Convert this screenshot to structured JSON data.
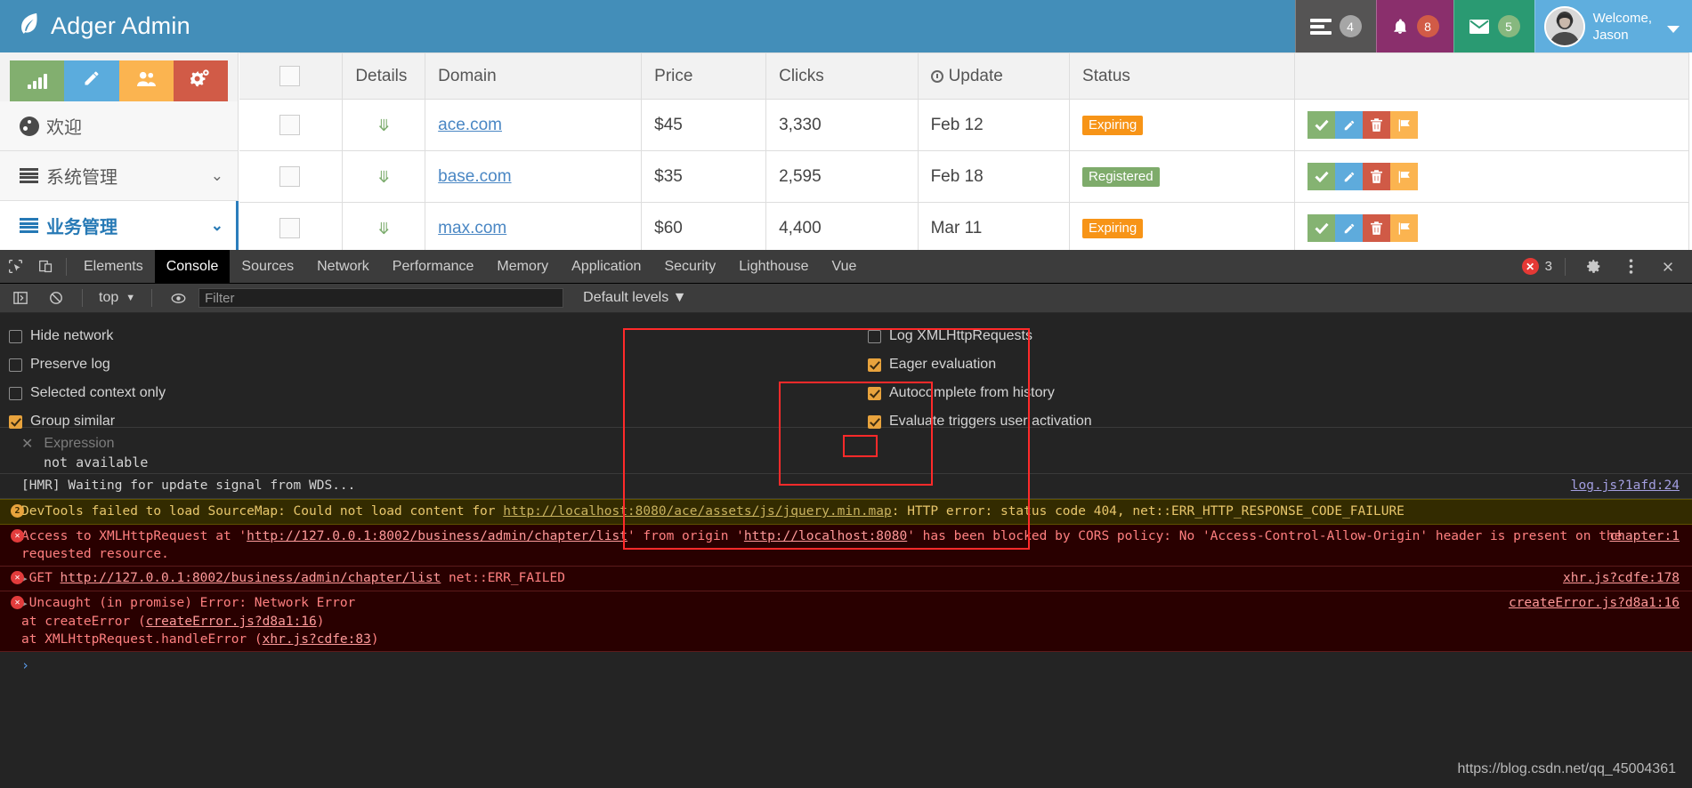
{
  "header": {
    "brand": "Adger Admin",
    "brand_icon": "leaf-icon",
    "tasks": {
      "icon": "tasks-icon",
      "count": "4"
    },
    "notifications": {
      "icon": "bell-icon",
      "count": "8"
    },
    "messages": {
      "icon": "envelope-icon",
      "count": "5"
    },
    "user": {
      "greeting": "Welcome,",
      "name": "Jason",
      "avatar": "user-avatar"
    }
  },
  "sidebar": {
    "quick_actions": [
      {
        "name": "stats-button",
        "icon": "bar-chart-icon",
        "color": "#82af6f"
      },
      {
        "name": "edit-button",
        "icon": "pencil-icon",
        "color": "#5bacdd"
      },
      {
        "name": "users-button",
        "icon": "group-icon",
        "color": "#fbb450"
      },
      {
        "name": "settings-button",
        "icon": "cogs-icon",
        "color": "#d15b47"
      }
    ],
    "items": [
      {
        "label": "欢迎",
        "icon": "dashboard-icon",
        "expandable": false,
        "active": false
      },
      {
        "label": "系统管理",
        "icon": "list-icon",
        "expandable": true,
        "active": false
      },
      {
        "label": "业务管理",
        "icon": "list-icon",
        "expandable": true,
        "active": true
      }
    ]
  },
  "table": {
    "columns": [
      "",
      "Details",
      "Domain",
      "Price",
      "Clicks",
      "Update",
      "Status",
      ""
    ],
    "update_icon": "clock-icon",
    "rows": [
      {
        "domain": "ace.com",
        "price": "$45",
        "clicks": "3,330",
        "update": "Feb 12",
        "status": "Expiring",
        "status_color": "#f79417"
      },
      {
        "domain": "base.com",
        "price": "$35",
        "clicks": "2,595",
        "update": "Feb 18",
        "status": "Registered",
        "status_color": "#7eab6b"
      },
      {
        "domain": "max.com",
        "price": "$60",
        "clicks": "4,400",
        "update": "Mar 11",
        "status": "Expiring",
        "status_color": "#f79417"
      }
    ],
    "row_actions": [
      {
        "name": "approve-button",
        "icon": "check-icon",
        "color": "#85b372"
      },
      {
        "name": "edit-button",
        "icon": "pencil-icon",
        "color": "#5eabdc"
      },
      {
        "name": "delete-button",
        "icon": "trash-icon",
        "color": "#d05a46"
      },
      {
        "name": "flag-button",
        "icon": "flag-icon",
        "color": "#fbb450"
      }
    ]
  },
  "devtools": {
    "tabs": [
      "Elements",
      "Console",
      "Sources",
      "Network",
      "Performance",
      "Memory",
      "Application",
      "Security",
      "Lighthouse",
      "Vue"
    ],
    "selected_tab": "Console",
    "error_count": "3",
    "toolbar": {
      "context": "top",
      "filter_placeholder": "Filter",
      "levels": "Default levels"
    },
    "settings_left": [
      {
        "label": "Hide network",
        "checked": false
      },
      {
        "label": "Preserve log",
        "checked": false
      },
      {
        "label": "Selected context only",
        "checked": false
      },
      {
        "label": "Group similar",
        "checked": true
      }
    ],
    "settings_right": [
      {
        "label": "Log XMLHttpRequests",
        "checked": false
      },
      {
        "label": "Eager evaluation",
        "checked": true
      },
      {
        "label": "Autocomplete from history",
        "checked": true
      },
      {
        "label": "Evaluate triggers user activation",
        "checked": true
      }
    ],
    "expression": {
      "placeholder": "Expression",
      "value": "not available",
      "close": "×"
    },
    "messages": [
      {
        "type": "log",
        "text": "[HMR] Waiting for update signal from WDS...",
        "source": "log.js?1afd:24"
      },
      {
        "type": "warn",
        "badge": "2",
        "text_parts": [
          {
            "t": "DevTools failed to load SourceMap: Could not load content for "
          },
          {
            "t": "http://localhost:8080/ace/assets/js/jquery.min.map",
            "link": true
          },
          {
            "t": ": HTTP error: status code 404, net::ERR_HTTP_RESPONSE_CODE_FAILURE"
          }
        ],
        "source": ""
      },
      {
        "type": "error",
        "text_parts": [
          {
            "t": "Access to XMLHttpRequest at '"
          },
          {
            "t": "http://127.0.0.1:8002/business/admin/chapter/list",
            "link": true
          },
          {
            "t": "' from origin '"
          },
          {
            "t": "http://localhost:8080",
            "link": true
          },
          {
            "t": "' has been blocked by CORS policy: No 'Access-Control-Allow-Origin' header is present on the requested resource."
          }
        ],
        "source": "chapter:1"
      },
      {
        "type": "error",
        "expandable": true,
        "text_parts": [
          {
            "t": "GET "
          },
          {
            "t": "http://127.0.0.1:8002/business/admin/chapter/list",
            "link": true
          },
          {
            "t": " net::ERR_FAILED"
          }
        ],
        "source": "xhr.js?cdfe:178"
      },
      {
        "type": "error",
        "expandable": true,
        "text_parts": [
          {
            "t": "Uncaught (in promise) Error: Network Error"
          }
        ],
        "stack": [
          {
            "pre": "    at createError (",
            "link": "createError.js?d8a1:16",
            "post": ")"
          },
          {
            "pre": "    at XMLHttpRequest.handleError (",
            "link": "xhr.js?cdfe:83",
            "post": ")"
          }
        ],
        "source": "createError.js?d8a1:16"
      }
    ],
    "prompt_symbol": "›",
    "watermark": "https://blog.csdn.net/qq_45004361"
  }
}
